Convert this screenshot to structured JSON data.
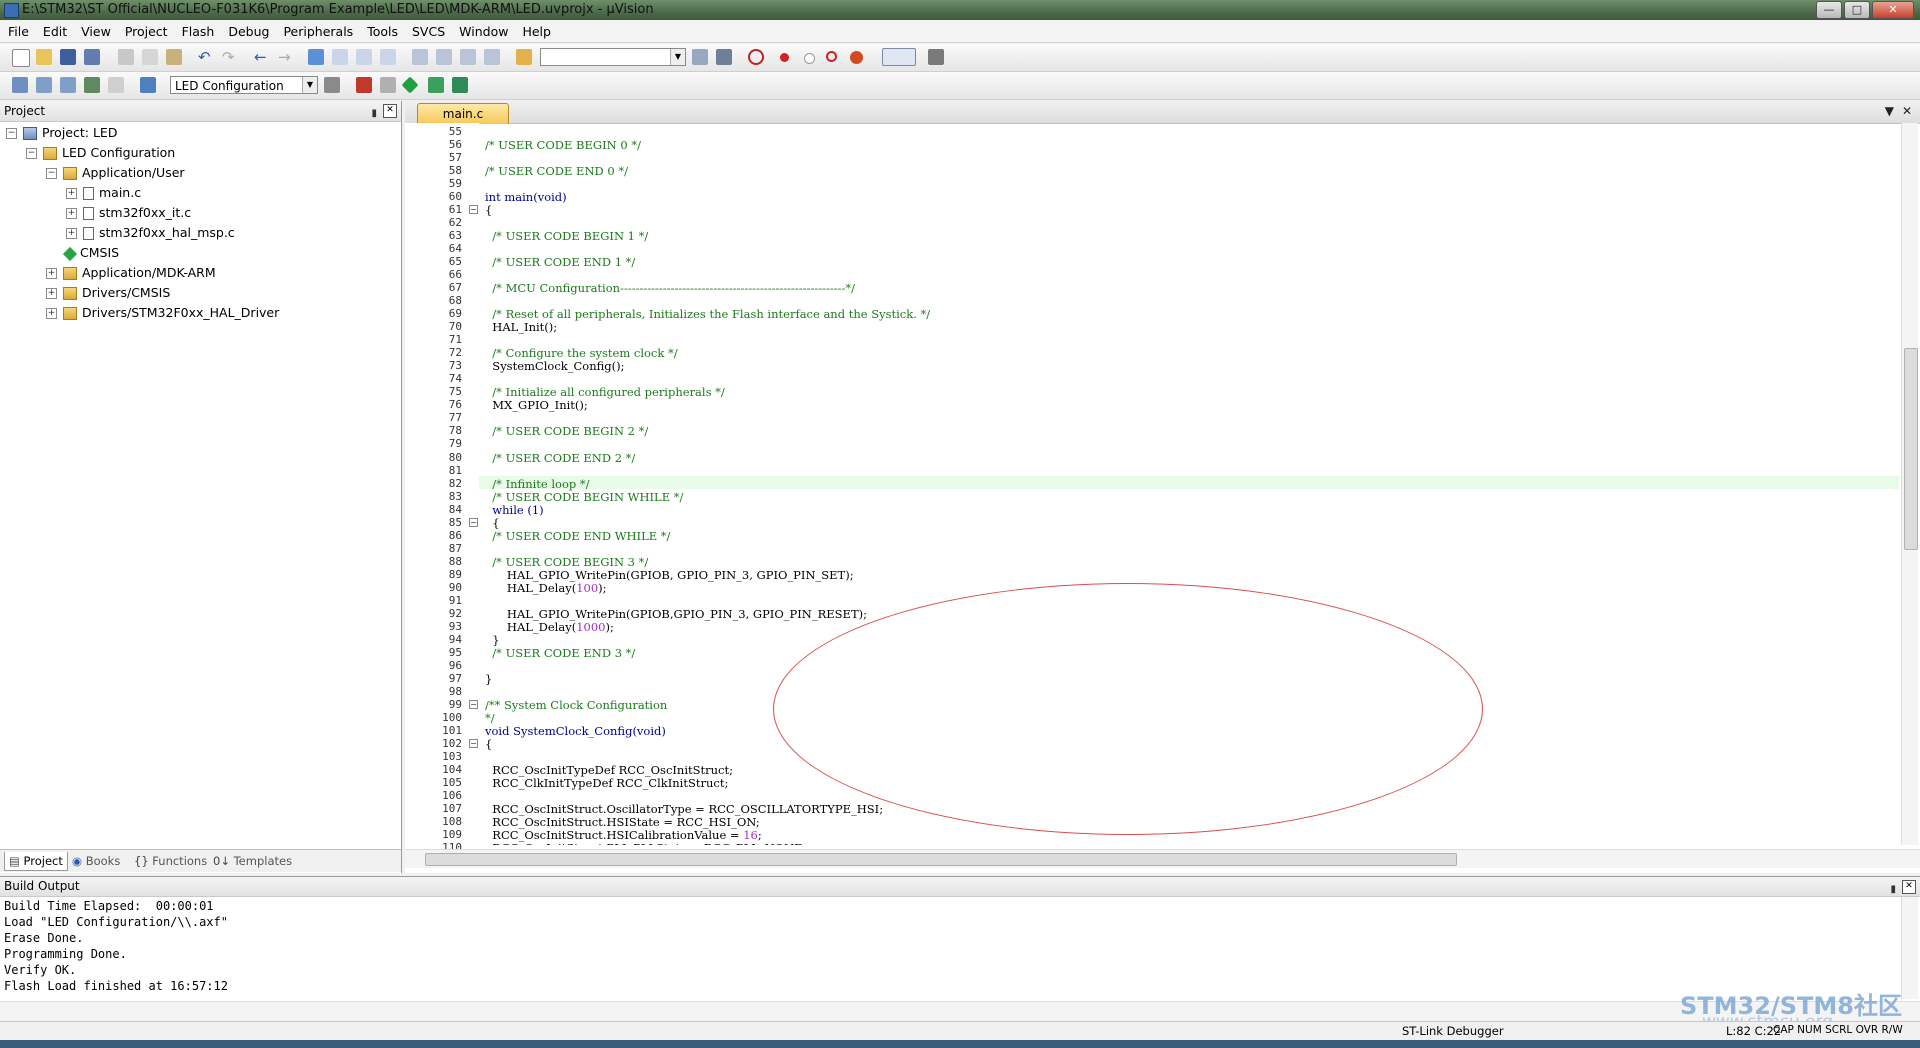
{
  "window": {
    "title": "E:\\STM32\\ST Official\\NUCLEO-F031K6\\Program Example\\LED\\LED\\MDK-ARM\\LED.uvprojx - µVision"
  },
  "menu": [
    "File",
    "Edit",
    "View",
    "Project",
    "Flash",
    "Debug",
    "Peripherals",
    "Tools",
    "SVCS",
    "Window",
    "Help"
  ],
  "toolbar": {
    "target_combo": "LED Configuration",
    "search_combo": ""
  },
  "project_panel": {
    "title": "Project",
    "tree": [
      {
        "label": "Project: LED",
        "depth": 0,
        "exp": "-",
        "icon": "project"
      },
      {
        "label": "LED Configuration",
        "depth": 1,
        "exp": "-",
        "icon": "folder"
      },
      {
        "label": "Application/User",
        "depth": 2,
        "exp": "-",
        "icon": "folder"
      },
      {
        "label": "main.c",
        "depth": 3,
        "exp": "+",
        "icon": "file"
      },
      {
        "label": "stm32f0xx_it.c",
        "depth": 3,
        "exp": "+",
        "icon": "file"
      },
      {
        "label": "stm32f0xx_hal_msp.c",
        "depth": 3,
        "exp": "+",
        "icon": "file"
      },
      {
        "label": "CMSIS",
        "depth": 2,
        "exp": "",
        "icon": "diamond"
      },
      {
        "label": "Application/MDK-ARM",
        "depth": 2,
        "exp": "+",
        "icon": "folder"
      },
      {
        "label": "Drivers/CMSIS",
        "depth": 2,
        "exp": "+",
        "icon": "folder"
      },
      {
        "label": "Drivers/STM32F0xx_HAL_Driver",
        "depth": 2,
        "exp": "+",
        "icon": "folder"
      }
    ],
    "tabs": [
      "Project",
      "Books",
      "Functions",
      "Templates"
    ]
  },
  "editor": {
    "tab": "main.c",
    "lines": [
      {
        "n": "55",
        "t": "",
        "c": ""
      },
      {
        "n": "56",
        "t": "/* USER CODE BEGIN 0 */",
        "c": "cm"
      },
      {
        "n": "57",
        "t": "",
        "c": ""
      },
      {
        "n": "58",
        "t": "/* USER CODE END 0 */",
        "c": "cm"
      },
      {
        "n": "59",
        "t": "",
        "c": ""
      },
      {
        "n": "60",
        "t": "int main(void)",
        "c": "kw"
      },
      {
        "n": "61",
        "t": "{",
        "c": "",
        "f": "-"
      },
      {
        "n": "62",
        "t": "",
        "c": ""
      },
      {
        "n": "63",
        "t": "  /* USER CODE BEGIN 1 */",
        "c": "cm"
      },
      {
        "n": "64",
        "t": "",
        "c": ""
      },
      {
        "n": "65",
        "t": "  /* USER CODE END 1 */",
        "c": "cm"
      },
      {
        "n": "66",
        "t": "",
        "c": ""
      },
      {
        "n": "67",
        "t": "  /* MCU Configuration----------------------------------------------------------*/",
        "c": "cm"
      },
      {
        "n": "68",
        "t": "",
        "c": ""
      },
      {
        "n": "69",
        "t": "  /* Reset of all peripherals, Initializes the Flash interface and the Systick. */",
        "c": "cm"
      },
      {
        "n": "70",
        "t": "  HAL_Init();",
        "c": ""
      },
      {
        "n": "71",
        "t": "",
        "c": ""
      },
      {
        "n": "72",
        "t": "  /* Configure the system clock */",
        "c": "cm"
      },
      {
        "n": "73",
        "t": "  SystemClock_Config();",
        "c": ""
      },
      {
        "n": "74",
        "t": "",
        "c": ""
      },
      {
        "n": "75",
        "t": "  /* Initialize all configured peripherals */",
        "c": "cm"
      },
      {
        "n": "76",
        "t": "  MX_GPIO_Init();",
        "c": ""
      },
      {
        "n": "77",
        "t": "",
        "c": ""
      },
      {
        "n": "78",
        "t": "  /* USER CODE BEGIN 2 */",
        "c": "cm"
      },
      {
        "n": "79",
        "t": "",
        "c": ""
      },
      {
        "n": "80",
        "t": "  /* USER CODE END 2 */",
        "c": "cm"
      },
      {
        "n": "81",
        "t": "",
        "c": ""
      },
      {
        "n": "82",
        "t": "  /* Infinite loop */",
        "c": "cm",
        "cur": true
      },
      {
        "n": "83",
        "t": "  /* USER CODE BEGIN WHILE */",
        "c": "cm"
      },
      {
        "n": "84",
        "t": "  while (1)",
        "c": "kw"
      },
      {
        "n": "85",
        "t": "  {",
        "c": "",
        "f": "-"
      },
      {
        "n": "86",
        "t": "  /* USER CODE END WHILE */",
        "c": "cm"
      },
      {
        "n": "87",
        "t": "",
        "c": ""
      },
      {
        "n": "88",
        "t": "  /* USER CODE BEGIN 3 */",
        "c": "cm"
      },
      {
        "n": "89",
        "t": "      HAL_GPIO_WritePin(GPIOB, GPIO_PIN_3, GPIO_PIN_SET);",
        "c": ""
      },
      {
        "n": "90",
        "t": "      HAL_Delay(100);",
        "c": ""
      },
      {
        "n": "91",
        "t": "",
        "c": ""
      },
      {
        "n": "92",
        "t": "      HAL_GPIO_WritePin(GPIOB,GPIO_PIN_3, GPIO_PIN_RESET);",
        "c": ""
      },
      {
        "n": "93",
        "t": "      HAL_Delay(1000);",
        "c": ""
      },
      {
        "n": "94",
        "t": "  }",
        "c": ""
      },
      {
        "n": "95",
        "t": "  /* USER CODE END 3 */",
        "c": "cm"
      },
      {
        "n": "96",
        "t": "",
        "c": ""
      },
      {
        "n": "97",
        "t": "}",
        "c": ""
      },
      {
        "n": "98",
        "t": "",
        "c": ""
      },
      {
        "n": "99",
        "t": "/** System Clock Configuration",
        "c": "cm",
        "f": "-"
      },
      {
        "n": "100",
        "t": "*/",
        "c": "cm"
      },
      {
        "n": "101",
        "t": "void SystemClock_Config(void)",
        "c": "kw"
      },
      {
        "n": "102",
        "t": "{",
        "c": "",
        "f": "-"
      },
      {
        "n": "103",
        "t": "",
        "c": ""
      },
      {
        "n": "104",
        "t": "  RCC_OscInitTypeDef RCC_OscInitStruct;",
        "c": ""
      },
      {
        "n": "105",
        "t": "  RCC_ClkInitTypeDef RCC_ClkInitStruct;",
        "c": ""
      },
      {
        "n": "106",
        "t": "",
        "c": ""
      },
      {
        "n": "107",
        "t": "  RCC_OscInitStruct.OscillatorType = RCC_OSCILLATORTYPE_HSI;",
        "c": ""
      },
      {
        "n": "108",
        "t": "  RCC_OscInitStruct.HSIState = RCC_HSI_ON;",
        "c": ""
      },
      {
        "n": "109",
        "t": "  RCC_OscInitStruct.HSICalibrationValue = 16;",
        "c": ""
      },
      {
        "n": "110",
        "t": "  RCC_OscInitStruct.PLL.PLLState = RCC_PLL_NONE;",
        "c": ""
      }
    ]
  },
  "build_output": {
    "title": "Build Output",
    "lines": [
      "Build Time Elapsed:  00:00:01",
      "Load \"LED Configuration/\\\\.axf\"",
      "Erase Done.",
      "Programming Done.",
      "Verify OK.",
      "Flash Load finished at 16:57:12"
    ]
  },
  "status": {
    "debugger": "ST-Link Debugger",
    "position": "L:82 C:22",
    "indicators": "CAP  NUM  SCRL  OVR  R/W"
  },
  "watermark": {
    "line1": "STM32/STM8社区",
    "line2": "www.stmcu.org"
  }
}
